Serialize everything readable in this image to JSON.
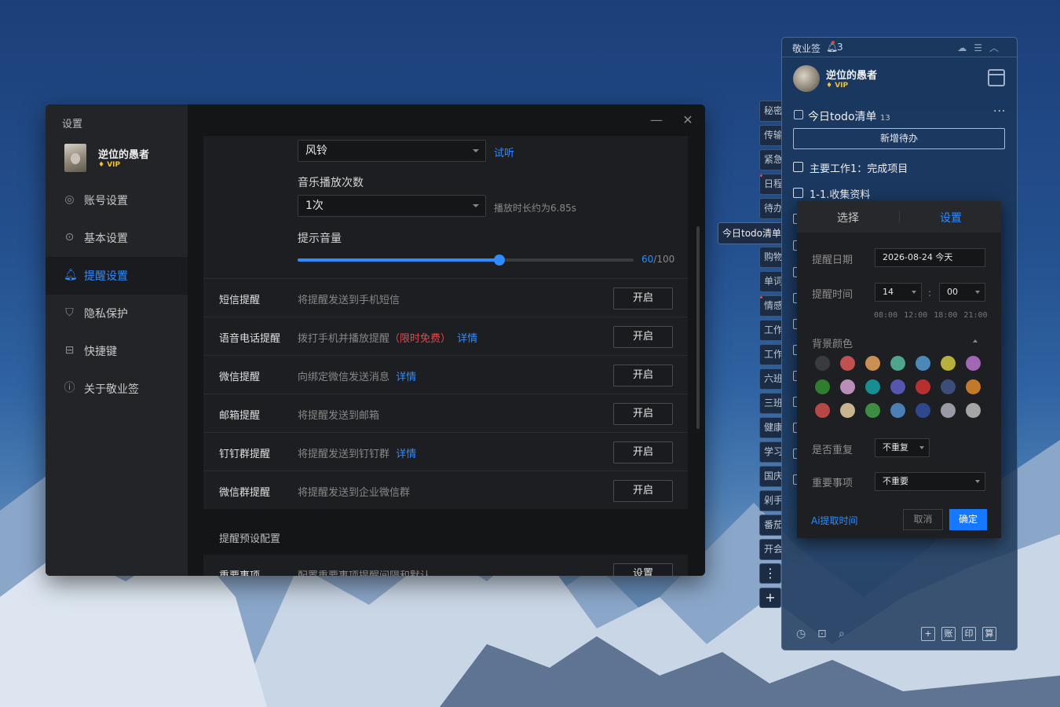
{
  "settings": {
    "window_title": "设置",
    "user": {
      "name": "逆位的愚者",
      "badge": "VIP"
    },
    "nav": [
      {
        "label": "账号设置",
        "icon": "user-circle-icon",
        "active": false
      },
      {
        "label": "基本设置",
        "icon": "gear-circle-icon",
        "active": false
      },
      {
        "label": "提醒设置",
        "icon": "bell-icon",
        "active": true
      },
      {
        "label": "隐私保护",
        "icon": "shield-icon",
        "active": false
      },
      {
        "label": "快捷键",
        "icon": "keyboard-icon",
        "active": false
      },
      {
        "label": "关于敬业签",
        "icon": "info-circle-icon",
        "active": false
      }
    ],
    "window_controls": {
      "minimize": "—",
      "close": "✕"
    },
    "ringtone": {
      "value": "风铃",
      "preview_link": "试听"
    },
    "play_count": {
      "label": "音乐播放次数",
      "value": "1次",
      "hint": "播放时长约为6.85s"
    },
    "volume": {
      "label": "提示音量",
      "value": 60,
      "max": 100,
      "value_text": "60",
      "max_text": "/100"
    },
    "channels": [
      {
        "title": "短信提醒",
        "desc": "将提醒发送到手机短信",
        "button": "开启"
      },
      {
        "title": "语音电话提醒",
        "desc": "拨打手机并播放提醒",
        "promo": "（限时免费）",
        "detail": "详情",
        "button": "开启"
      },
      {
        "title": "微信提醒",
        "desc": "向绑定微信发送消息",
        "detail": "详情",
        "button": "开启"
      },
      {
        "title": "邮箱提醒",
        "desc": "将提醒发送到邮箱",
        "button": "开启"
      },
      {
        "title": "钉钉群提醒",
        "desc": "将提醒发送到钉钉群",
        "detail": "详情",
        "button": "开启"
      },
      {
        "title": "微信群提醒",
        "desc": "将提醒发送到企业微信群",
        "button": "开启"
      }
    ],
    "preset_section": {
      "title": "提醒预设配置",
      "row_title": "重要事项",
      "row_desc": "配置重要事项提醒间隔和默认",
      "button": "设置"
    }
  },
  "tags": [
    "秘密",
    "传输",
    "紧急",
    "日程",
    "待办",
    "今日todo清单",
    "购物",
    "单词",
    "情感",
    "工作",
    "工作",
    "六班",
    "三班",
    "健康",
    "学习",
    "国庆",
    "剁手",
    "番茄",
    "开会"
  ],
  "tag_buttons": {
    "more": "⋮",
    "add": "+"
  },
  "note": {
    "app_name": "敬业签",
    "notification_count": "3",
    "user": {
      "name": "逆位的愚者",
      "badge": "VIP"
    },
    "list_title": "今日todo清单",
    "list_count": "13",
    "more_icon": "···",
    "add_button": "新增待办",
    "todos": [
      {
        "text": "主要工作1：完成项目"
      },
      {
        "text": "1-1.收集资料"
      }
    ],
    "bottom_icons": [
      "clock-icon",
      "archive-icon",
      "search-icon"
    ],
    "bottom_tools": [
      "+",
      "账",
      "印",
      "算"
    ]
  },
  "popup": {
    "tabs": {
      "select": "选择",
      "settings": "设置"
    },
    "date_label": "提醒日期",
    "date_value": "2026-08-24 今天",
    "time_label": "提醒时间",
    "hour": "14",
    "minute": "00",
    "colon": ":",
    "quick_times": [
      "08:00",
      "12:00",
      "18:00",
      "21:00"
    ],
    "color_label": "背景颜色",
    "colors": [
      "#3a3b3f",
      "#c15050",
      "#c98f55",
      "#4fa48e",
      "#4b88b8",
      "#b7b03c",
      "#a167b5",
      "#2f7e2f",
      "#b98fb8",
      "#178f92",
      "#5556b0",
      "#b82f2f",
      "#3b4e79",
      "#c07a2a",
      "#b84848",
      "#c8b48f",
      "#3d8d45",
      "#4c7fb7",
      "#2f478c",
      "#9a9aa6",
      "#a5a5a5"
    ],
    "repeat_label": "是否重复",
    "repeat_value": "不重复",
    "important_label": "重要事项",
    "important_value": "不重要",
    "ai_link": "Ai提取时间",
    "cancel": "取消",
    "ok": "确定"
  }
}
